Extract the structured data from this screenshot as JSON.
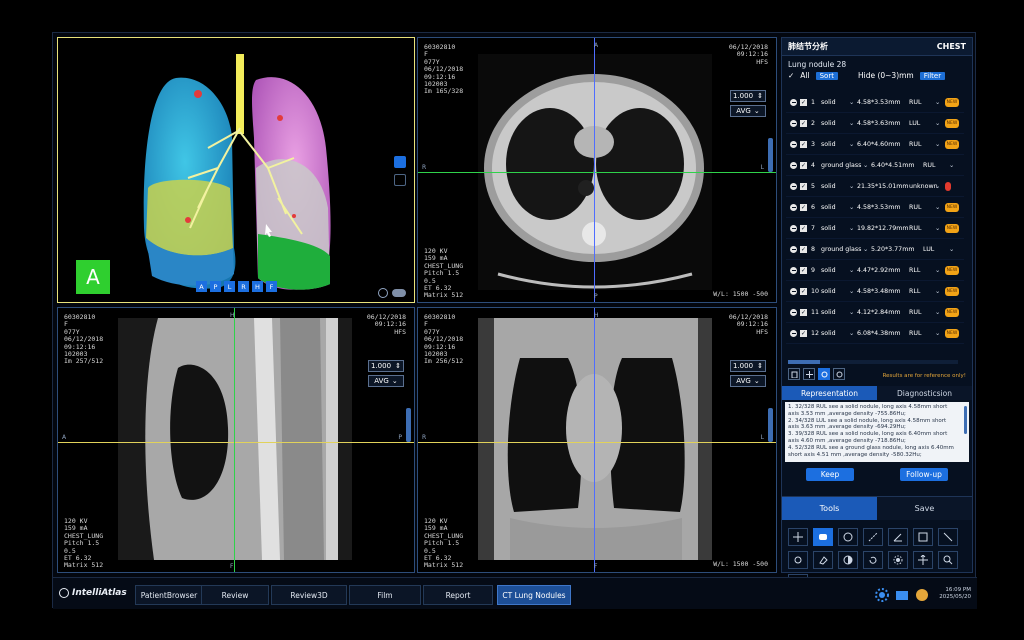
{
  "viewports": {
    "vr3d": {
      "orientation_marker": "A",
      "orient_buttons": [
        "A",
        "P",
        "L",
        "R",
        "H",
        "F"
      ]
    },
    "axial": {
      "tl": [
        "60302810",
        "F",
        "077Y",
        "06/12/2018",
        "09:12:16",
        "102003",
        "Im 165/328"
      ],
      "tr": [
        "06/12/2018",
        "09:12:16",
        "HFS"
      ],
      "bl": [
        "120 KV",
        "159 mA",
        "CHEST_LUNG",
        "Pitch 1.5",
        "0.5",
        "ET 6.32",
        "Matrix 512"
      ],
      "zoom": "1.000",
      "mode": "AVG",
      "wl": "W/L: 1500 -500",
      "edges": {
        "top": "A",
        "bottom": "P",
        "left": "R",
        "right": "L"
      }
    },
    "sagittal": {
      "tl": [
        "60302810",
        "F",
        "077Y",
        "06/12/2018",
        "09:12:16",
        "102003",
        "Im 257/512"
      ],
      "tr": [
        "06/12/2018",
        "09:12:16",
        "HFS"
      ],
      "bl": [
        "120 KV",
        "159 mA",
        "CHEST_LUNG",
        "Pitch 1.5",
        "0.5",
        "ET 6.32",
        "Matrix 512"
      ],
      "zoom": "1.000",
      "mode": "AVG",
      "edges": {
        "top": "H",
        "bottom": "F",
        "left": "A",
        "right": "P"
      }
    },
    "coronal": {
      "tl": [
        "60302810",
        "F",
        "077Y",
        "06/12/2018",
        "09:12:16",
        "102003",
        "Im 256/512"
      ],
      "tr": [
        "06/12/2018",
        "09:12:16",
        "HFS"
      ],
      "bl": [
        "120 KV",
        "159 mA",
        "CHEST_LUNG",
        "Pitch 1.5",
        "0.5",
        "ET 6.32",
        "Matrix 512"
      ],
      "zoom": "1.000",
      "mode": "AVG",
      "wl": "W/L: 1500 -500",
      "edges": {
        "top": "H",
        "bottom": "F",
        "left": "R",
        "right": "L"
      }
    }
  },
  "panel": {
    "title": "肺结节分析",
    "region": "CHEST",
    "nodule_header": "Lung nodule 28",
    "all_label": "All",
    "sort_label": "Sort",
    "hide_label": "Hide (0~3)mm",
    "filter_label": "Filter",
    "nodules": [
      {
        "num": "1",
        "type": "solid",
        "size": "4.58*3.53mm",
        "loc": "RUL",
        "ai": "orange"
      },
      {
        "num": "2",
        "type": "solid",
        "size": "4.58*3.63mm",
        "loc": "LUL",
        "ai": "orange"
      },
      {
        "num": "3",
        "type": "solid",
        "size": "6.40*4.60mm",
        "loc": "RUL",
        "ai": "orange"
      },
      {
        "num": "4",
        "type": "ground glass",
        "size": "6.40*4.51mm",
        "loc": "RUL",
        "ai": "none"
      },
      {
        "num": "5",
        "type": "solid",
        "size": "21.35*15.01mm",
        "loc": "unknown",
        "ai": "red"
      },
      {
        "num": "6",
        "type": "solid",
        "size": "4.58*3.53mm",
        "loc": "RUL",
        "ai": "orange"
      },
      {
        "num": "7",
        "type": "solid",
        "size": "19.82*12.79mm",
        "loc": "RUL",
        "ai": "orange"
      },
      {
        "num": "8",
        "type": "ground glass",
        "size": "5.20*3.77mm",
        "loc": "LUL",
        "ai": "none"
      },
      {
        "num": "9",
        "type": "solid",
        "size": "4.47*2.92mm",
        "loc": "RLL",
        "ai": "orange"
      },
      {
        "num": "10",
        "type": "solid",
        "size": "4.58*3.48mm",
        "loc": "RLL",
        "ai": "orange"
      },
      {
        "num": "11",
        "type": "solid",
        "size": "4.12*2.84mm",
        "loc": "RUL",
        "ai": "orange"
      },
      {
        "num": "12",
        "type": "solid",
        "size": "6.08*4.38mm",
        "loc": "RUL",
        "ai": "orange"
      }
    ],
    "ai_badge": "NEW",
    "disclaimer": "Results are for reference only!",
    "tabs": [
      "Representation",
      "Diagnosticsion"
    ],
    "report_lines": [
      "1. 32/328 RUL see a solid nodule, long axis 4.58mm short",
      "axis 3.53 mm ,average density -755.86Hu;",
      "2. 34/328 LUL see a solid nodule, long axis 4.58mm short",
      "axis 3.63 mm ,average density -694.29Hu;",
      "3. 39/328 RUL see a solid nodule, long axis 6.40mm short",
      "axis 4.60 mm ,average density -718.86Hu;",
      "4. 52/328 RUL see a ground glass nodule, long axis 6.40mm",
      "short axis 4.51 mm ,average density -580.32Hu;"
    ],
    "keep_label": "Keep",
    "followup_label": "Follow-up",
    "tools_label": "Tools",
    "save_label": "Save"
  },
  "taskbar": {
    "logo": "IntelliAtlas",
    "tabs": [
      "PatientBrowser",
      "Review",
      "Review3D",
      "Film",
      "Report",
      "CT Lung Nodules"
    ],
    "active_tab": "CT Lung Nodules",
    "time": "16:09 PM",
    "date": "2025/05/20"
  },
  "colors": {
    "accent": "#1c6fe0",
    "ai_badge": "#f2a316",
    "ai_alert": "#e23a2e",
    "crosshair_green": "#2fd24a",
    "crosshair_blue": "#4f6dff",
    "crosshair_yellow": "#e1d25a"
  }
}
